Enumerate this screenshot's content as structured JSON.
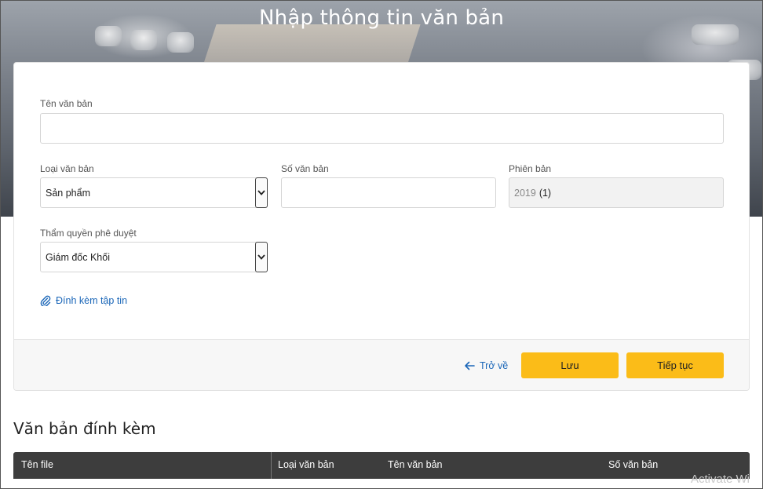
{
  "header": {
    "title": "Nhập thông tin văn bản"
  },
  "form": {
    "document_name": {
      "label": "Tên văn bản",
      "value": ""
    },
    "document_type": {
      "label": "Loại văn bản",
      "selected": "Sản phẩm"
    },
    "document_number": {
      "label": "Số văn bản",
      "value": ""
    },
    "version": {
      "label": "Phiên bản",
      "value": "2019",
      "suffix": "(1)"
    },
    "approval_authority": {
      "label": "Thẩm quyền phê duyệt",
      "selected": "Giám đốc Khối"
    },
    "attach_label": "Đính kèm tập tin"
  },
  "actions": {
    "back_label": "Trở về",
    "save_label": "Lưu",
    "continue_label": "Tiếp tục"
  },
  "attachments": {
    "title": "Văn bản đính kèm",
    "columns": [
      "Tên file",
      "Loại văn bản",
      "Tên văn bản",
      "Số văn bản"
    ]
  },
  "watermark": "Activate Wi",
  "colors": {
    "primary_button": "#fbbc18",
    "link": "#1a66b8",
    "table_header": "#3d3d3d"
  }
}
